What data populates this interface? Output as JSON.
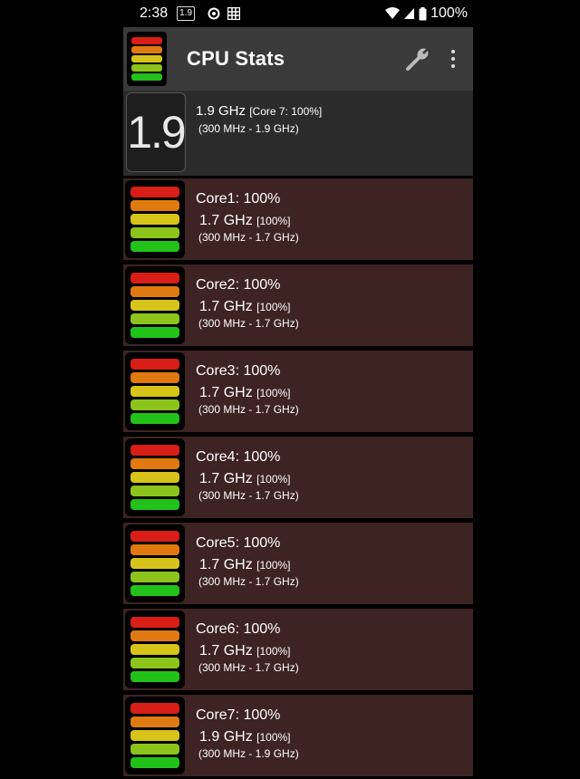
{
  "status_bar": {
    "time": "2:38",
    "badge": "1.9",
    "battery": "100%"
  },
  "app_bar": {
    "title": "CPU Stats",
    "icons": [
      "app-logo-icon",
      "wrench-icon",
      "overflow-menu-icon"
    ]
  },
  "summary": {
    "big_value": "1.9",
    "freq": "1.9 GHz",
    "core_note": "[Core 7: 100%]",
    "range": "(300 MHz - 1.9 GHz)"
  },
  "bar_colors": [
    "#d81e17",
    "#e07a10",
    "#d7c41a",
    "#8cc41c",
    "#22c21a"
  ],
  "cores": [
    {
      "name": "Core1: 100%",
      "freq": "1.7 GHz",
      "pct": "[100%]",
      "range": "(300 MHz - 1.7 GHz)",
      "load": 1.0
    },
    {
      "name": "Core2: 100%",
      "freq": "1.7 GHz",
      "pct": "[100%]",
      "range": "(300 MHz - 1.7 GHz)",
      "load": 1.0
    },
    {
      "name": "Core3: 100%",
      "freq": "1.7 GHz",
      "pct": "[100%]",
      "range": "(300 MHz - 1.7 GHz)",
      "load": 1.0
    },
    {
      "name": "Core4: 100%",
      "freq": "1.7 GHz",
      "pct": "[100%]",
      "range": "(300 MHz - 1.7 GHz)",
      "load": 1.0
    },
    {
      "name": "Core5: 100%",
      "freq": "1.7 GHz",
      "pct": "[100%]",
      "range": "(300 MHz - 1.7 GHz)",
      "load": 1.0
    },
    {
      "name": "Core6: 100%",
      "freq": "1.7 GHz",
      "pct": "[100%]",
      "range": "(300 MHz - 1.7 GHz)",
      "load": 1.0
    },
    {
      "name": "Core7: 100%",
      "freq": "1.9 GHz",
      "pct": "[100%]",
      "range": "(300 MHz - 1.9 GHz)",
      "load": 1.0
    }
  ]
}
